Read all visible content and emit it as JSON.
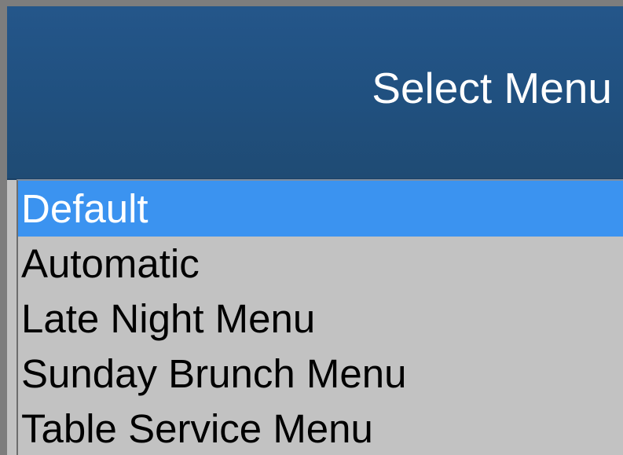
{
  "dialog": {
    "title": "Select Menu"
  },
  "menu_list": {
    "selected_index": 0,
    "items": [
      {
        "label": "Default"
      },
      {
        "label": "Automatic"
      },
      {
        "label": "Late Night Menu"
      },
      {
        "label": "Sunday Brunch Menu"
      },
      {
        "label": "Table Service Menu"
      }
    ]
  },
  "colors": {
    "header_background": "#225282",
    "selection_highlight": "#3b93f0",
    "list_background": "#c2c2c2",
    "outer_background": "#7d7d7d"
  }
}
